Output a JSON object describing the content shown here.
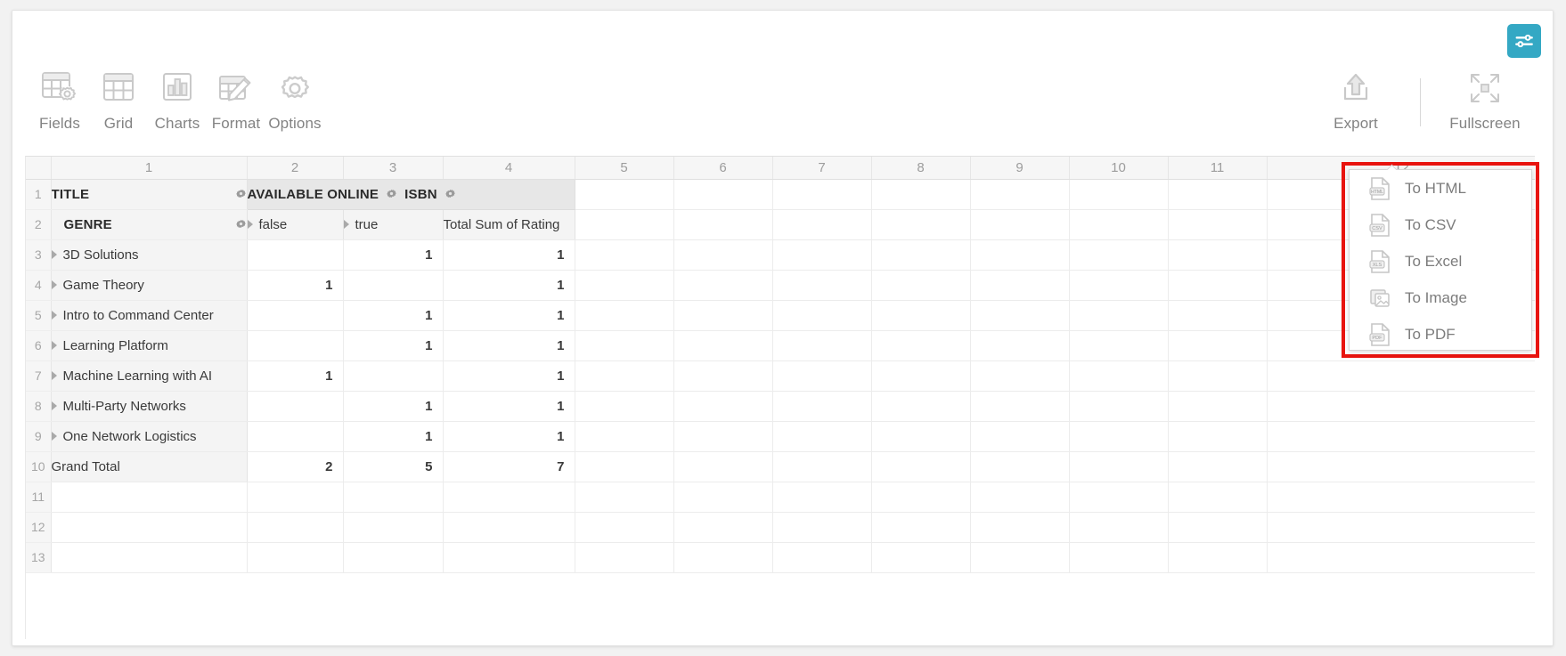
{
  "theme": {
    "accent": "#34a8c4",
    "highlight_border": "#e8140f",
    "text_gray": "#838383"
  },
  "config_button": {
    "icon": "sliders-icon",
    "label": ""
  },
  "toolbar": {
    "left_items": [
      {
        "label": "Fields",
        "icon": "fields-grid-gear-icon"
      },
      {
        "label": "Grid",
        "icon": "grid-icon"
      },
      {
        "label": "Charts",
        "icon": "bar-chart-icon"
      },
      {
        "label": "Format",
        "icon": "format-pencil-icon"
      },
      {
        "label": "Options",
        "icon": "gear-icon"
      }
    ],
    "right_items": [
      {
        "label": "Export",
        "icon": "upload-arrow-icon"
      },
      {
        "label": "Fullscreen",
        "icon": "expand-arrows-icon"
      }
    ]
  },
  "export_menu": {
    "items": [
      {
        "label": "To HTML",
        "icon": "file-html-icon",
        "badge": "HTML"
      },
      {
        "label": "To CSV",
        "icon": "file-csv-icon",
        "badge": "CSV"
      },
      {
        "label": "To Excel",
        "icon": "file-xls-icon",
        "badge": "XLS"
      },
      {
        "label": "To Image",
        "icon": "file-image-icon",
        "badge": ""
      },
      {
        "label": "To PDF",
        "icon": "file-pdf-icon",
        "badge": "PDF"
      }
    ]
  },
  "grid": {
    "column_headers": [
      "1",
      "2",
      "3",
      "4",
      "5",
      "6",
      "7",
      "8",
      "9",
      "10",
      "11",
      "12"
    ],
    "row_numbers": [
      "1",
      "2",
      "3",
      "4",
      "5",
      "6",
      "7",
      "8",
      "9",
      "10",
      "11",
      "12",
      "13"
    ],
    "field_header": {
      "col1": "TITLE",
      "col2": "AVAILABLE ONLINE",
      "col3": "ISBN"
    },
    "sub_header": {
      "col1": "GENRE",
      "col2": "false",
      "col3": "true",
      "col4": "Total Sum of Rating"
    },
    "rows": [
      {
        "label": "3D Solutions",
        "false": "",
        "true": "1",
        "total": "1"
      },
      {
        "label": "Game Theory",
        "false": "1",
        "true": "",
        "total": "1"
      },
      {
        "label": "Intro to Command Center",
        "false": "",
        "true": "1",
        "total": "1"
      },
      {
        "label": "Learning Platform",
        "false": "",
        "true": "1",
        "total": "1"
      },
      {
        "label": "Machine Learning with AI",
        "false": "1",
        "true": "",
        "total": "1"
      },
      {
        "label": "Multi-Party Networks",
        "false": "",
        "true": "1",
        "total": "1"
      },
      {
        "label": "One Network Logistics",
        "false": "",
        "true": "1",
        "total": "1"
      }
    ],
    "grand_total": {
      "label": "Grand Total",
      "false": "2",
      "true": "5",
      "total": "7"
    }
  }
}
